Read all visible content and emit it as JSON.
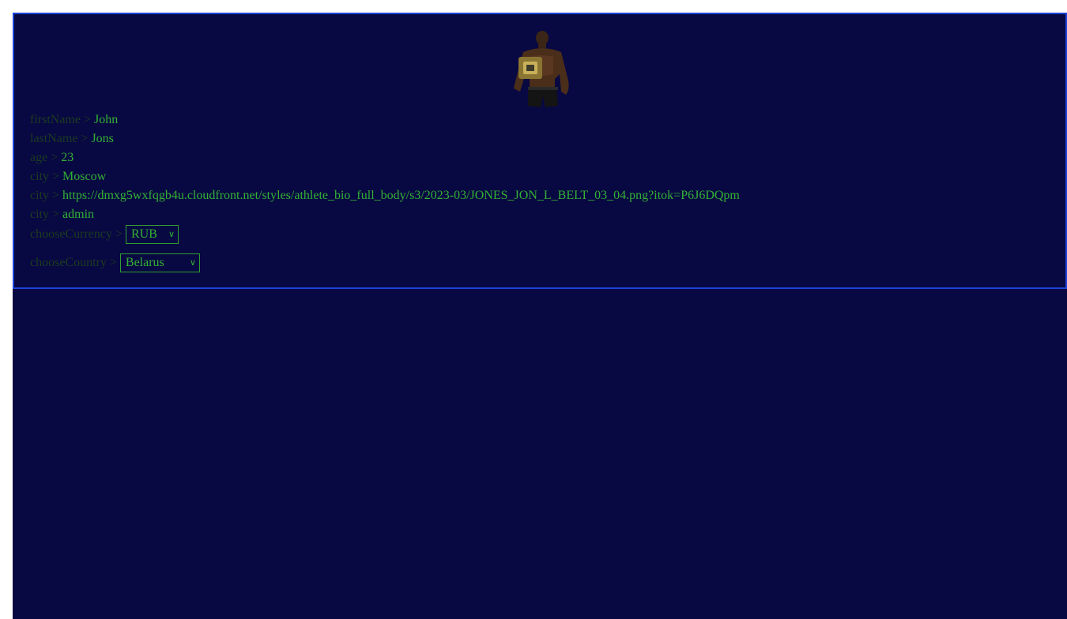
{
  "profile": {
    "fields": [
      {
        "key": "firstName",
        "value": "John"
      },
      {
        "key": "lastName",
        "value": "Jons"
      },
      {
        "key": "age",
        "value": "23"
      },
      {
        "key": "city",
        "value": "Moscow"
      },
      {
        "key": "city",
        "value": "https://dmxg5wxfqgb4u.cloudfront.net/styles/athlete_bio_full_body/s3/2023-03/JONES_JON_L_BELT_03_04.png?itok=P6J6DQpm"
      },
      {
        "key": "city",
        "value": "admin"
      }
    ],
    "currency": {
      "label": "chooseCurrency",
      "selected": "RUB"
    },
    "country": {
      "label": "chooseCountry",
      "selected": "Belarus"
    },
    "separator": " > "
  },
  "colors": {
    "background": "#080842",
    "border": "#1c44d9",
    "value_text": "#33b233",
    "key_text": "#1c3d1f"
  },
  "icons": {
    "dropdown": "chevron-down-icon"
  }
}
